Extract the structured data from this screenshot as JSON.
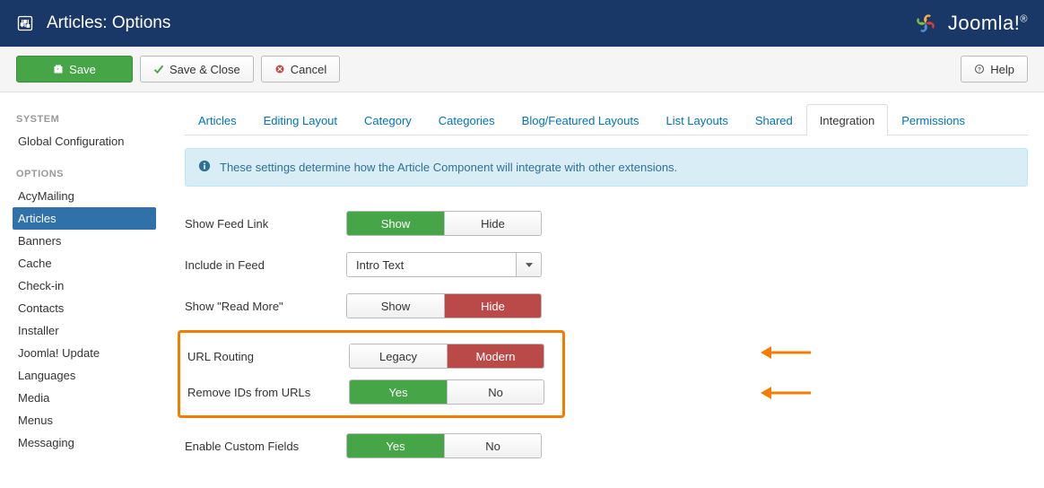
{
  "header": {
    "title": "Articles: Options",
    "brand": "Joomla!"
  },
  "toolbar": {
    "save": "Save",
    "save_close": "Save & Close",
    "cancel": "Cancel",
    "help": "Help"
  },
  "sidebar": {
    "group_system": "SYSTEM",
    "system_items": [
      "Global Configuration"
    ],
    "group_options": "OPTIONS",
    "options_items": [
      "AcyMailing",
      "Articles",
      "Banners",
      "Cache",
      "Check-in",
      "Contacts",
      "Installer",
      "Joomla! Update",
      "Languages",
      "Media",
      "Menus",
      "Messaging"
    ],
    "active": "Articles"
  },
  "tabs": {
    "items": [
      "Articles",
      "Editing Layout",
      "Category",
      "Categories",
      "Blog/Featured Layouts",
      "List Layouts",
      "Shared",
      "Integration",
      "Permissions"
    ],
    "active": "Integration"
  },
  "alert": "These settings determine how the Article Component will integrate with other extensions.",
  "fields": {
    "show_feed_link": {
      "label": "Show Feed Link",
      "opt1": "Show",
      "opt2": "Hide",
      "selected": 1
    },
    "include_in_feed": {
      "label": "Include in Feed",
      "value": "Intro Text"
    },
    "show_read_more": {
      "label": "Show \"Read More\"",
      "opt1": "Show",
      "opt2": "Hide",
      "selected": 2
    },
    "url_routing": {
      "label": "URL Routing",
      "opt1": "Legacy",
      "opt2": "Modern",
      "selected": 2
    },
    "remove_ids": {
      "label": "Remove IDs from URLs",
      "opt1": "Yes",
      "opt2": "No",
      "selected": 1
    },
    "custom_fields": {
      "label": "Enable Custom Fields",
      "opt1": "Yes",
      "opt2": "No",
      "selected": 1
    }
  }
}
